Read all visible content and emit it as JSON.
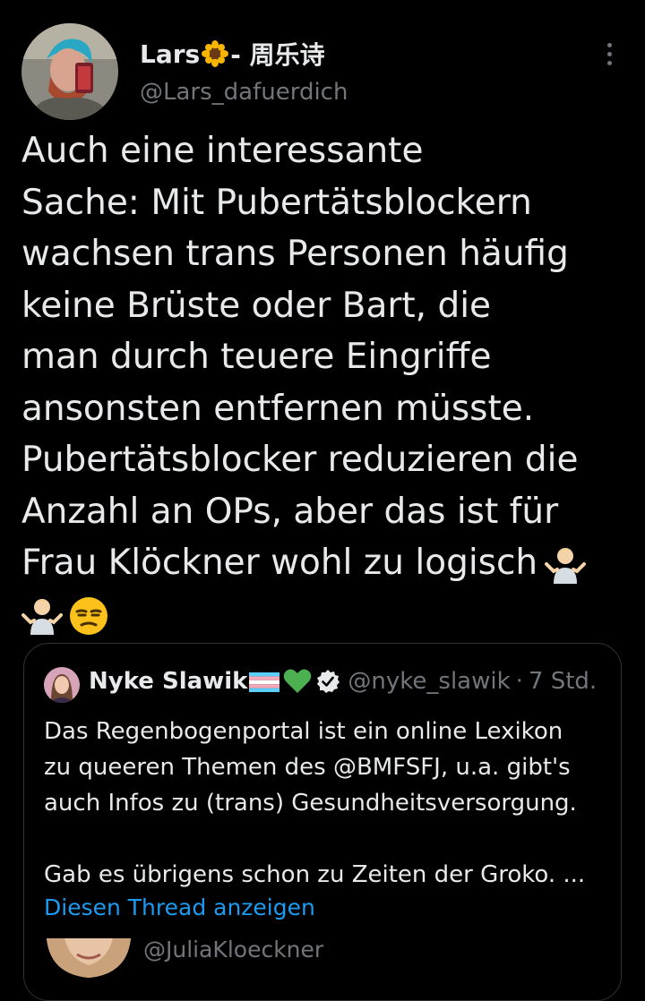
{
  "tweet": {
    "author_name": "Lars",
    "author_name_suffix": "- 周乐诗",
    "author_handle": "@Lars_dafuerdich",
    "text_lines": [
      "Auch eine interessante",
      "Sache: Mit Pubertätsblockern",
      "wachsen trans Personen häufig",
      "keine Brüste oder Bart, die",
      "man durch teuere Eingriffe",
      "ansonsten entfernen müsste.",
      "Pubertätsblocker reduzieren die",
      "Anzahl an OPs, aber das ist für",
      "Frau Klöckner wohl zu logisch"
    ],
    "emojis": [
      "man-shrugging-icon",
      "man-shrugging-icon",
      "unamused-face-icon"
    ]
  },
  "quote": {
    "author_name": "Nyke Slawik",
    "author_handle": "@nyke_slawik",
    "separator": "·",
    "time": "7 Std.",
    "text_lines": [
      "Das Regenbogenportal ist ein online Lexikon",
      "zu queeren Themen des @BMFSFJ, u.a. gibt's",
      "auch Infos zu (trans) Gesundheitsversorgung."
    ],
    "text_line_2": "Gab es übrigens schon zu Zeiten der Groko. ...",
    "thread_link": "Diesen Thread anzeigen"
  },
  "next_tweet": {
    "handle": "@JuliaKloeckner"
  },
  "colors": {
    "background": "#000000",
    "text_primary": "#e7e9ea",
    "text_secondary": "#71767b",
    "link": "#1d9bf0",
    "border": "#2f3336"
  }
}
